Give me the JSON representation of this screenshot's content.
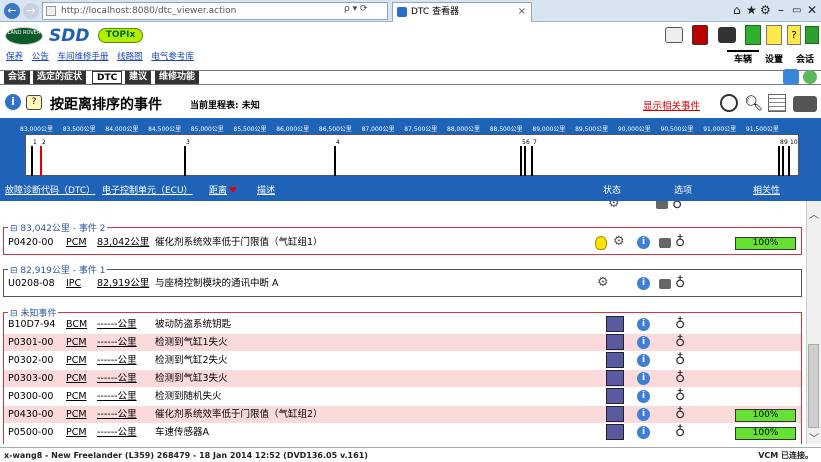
{
  "browser": {
    "url": "http://localhost:8080/dtc_viewer.action",
    "tab_title": "DTC 查看器",
    "address_tools": "ρ ▾ ⟳"
  },
  "app": {
    "logo_landrover": "LAND ROVER",
    "logo_sdd": "SDD",
    "logo_topix": "TOPIx",
    "top_links": [
      "保养",
      "公告",
      "车间维修手册",
      "线路图",
      "电气参考库"
    ],
    "right_tabs": [
      "车辆",
      "设置",
      "会话"
    ],
    "nav_tabs": [
      "会话",
      "选定的症状",
      "DTC",
      "建议",
      "维修功能"
    ],
    "active_nav_tab": "DTC"
  },
  "page": {
    "title": "按距离排序的事件",
    "odometer": "当前里程表: 未知",
    "show_related": "显示相关事件"
  },
  "timeline": {
    "labels": [
      "83,000公里",
      "83,500公里",
      "84,000公里",
      "84,500公里",
      "85,000公里",
      "85,500公里",
      "86,000公里",
      "86,500公里",
      "87,000公里",
      "87,500公里",
      "88,000公里",
      "88,500公里",
      "89,000公里",
      "89,500公里",
      "90,000公里",
      "90,500公里",
      "91,000公里",
      "91,500公里"
    ],
    "markers": [
      {
        "label": "1",
        "color": "black"
      },
      {
        "label": "2",
        "color": "red"
      },
      {
        "label": "3",
        "color": "black"
      },
      {
        "label": "4",
        "color": "black"
      },
      {
        "label": "5",
        "color": "black"
      },
      {
        "label": "6",
        "color": "black"
      },
      {
        "label": "7",
        "color": "black"
      },
      {
        "label": "8",
        "color": "black"
      },
      {
        "label": "9",
        "color": "black"
      },
      {
        "label": "10",
        "color": "black"
      }
    ]
  },
  "table_header": {
    "col_dtc": "故障诊断代码（DTC）",
    "col_ecu": "电子控制单元（ECU）",
    "col_distance": "距离",
    "col_desc": "描述",
    "col_status": "状态",
    "col_options": "选项",
    "col_relevance": "相关性"
  },
  "groups": [
    {
      "label": "83,042公里 - 事件 2",
      "rows": [
        {
          "code": "P0420-00",
          "ecu": "PCM",
          "distance": "83,042公里",
          "desc": "催化剂系统效率低于门限值（气缸组1）",
          "relevance": "100%"
        }
      ]
    },
    {
      "label": "82,919公里 - 事件 1",
      "rows": [
        {
          "code": "U0208-08",
          "ecu": "IPC",
          "distance": "82,919公里",
          "desc": "与座椅控制模块的通讯中断 A",
          "relevance": ""
        }
      ]
    },
    {
      "label": "未知事件",
      "rows": [
        {
          "code": "B10D7-94",
          "ecu": "BCM",
          "distance": "------公里",
          "desc": "被动防盗系统钥匙",
          "relevance": ""
        },
        {
          "code": "P0301-00",
          "ecu": "PCM",
          "distance": "------公里",
          "desc": "检测到气缸1失火",
          "relevance": ""
        },
        {
          "code": "P0302-00",
          "ecu": "PCM",
          "distance": "------公里",
          "desc": "检测到气缸2失火",
          "relevance": ""
        },
        {
          "code": "P0303-00",
          "ecu": "PCM",
          "distance": "------公里",
          "desc": "检测到气缸3失火",
          "relevance": ""
        },
        {
          "code": "P0300-00",
          "ecu": "PCM",
          "distance": "------公里",
          "desc": "检测到随机失火",
          "relevance": ""
        },
        {
          "code": "P0430-00",
          "ecu": "PCM",
          "distance": "------公里",
          "desc": "催化剂系统效率低于门限值（气缸组2）",
          "relevance": "100%"
        },
        {
          "code": "P0500-00",
          "ecu": "PCM",
          "distance": "------公里",
          "desc": "车速传感器A",
          "relevance": "100%"
        }
      ]
    }
  ],
  "status_bar": {
    "left": "x-wang8 - New Freelander (L359) 268479 - 18 Jan 2014 12:52 (DVD136.05 v.161)",
    "right": "VCM 已连接。"
  },
  "colors": {
    "accent_blue": "#1e63b8",
    "event_border": "#e03040",
    "relevance_green": "#66e033"
  }
}
